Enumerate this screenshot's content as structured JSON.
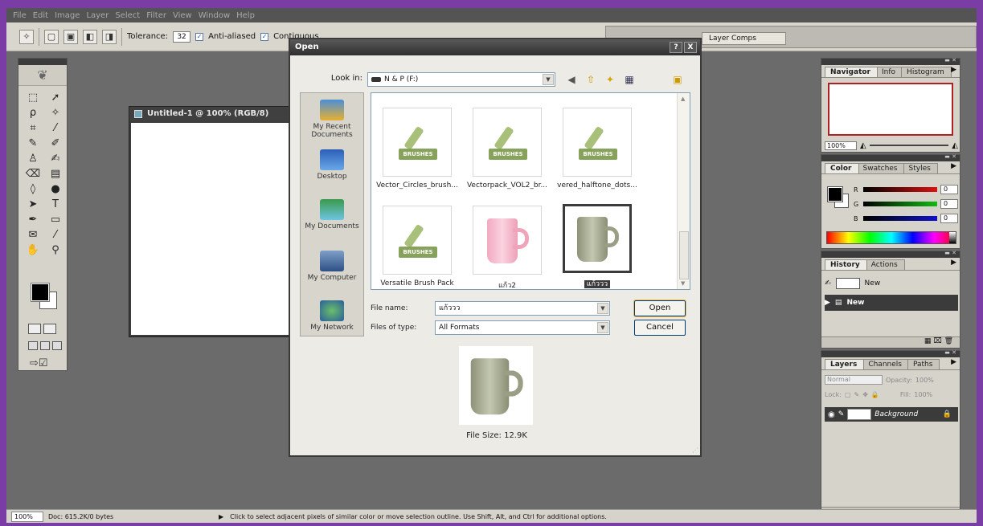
{
  "menubar": [
    "File",
    "Edit",
    "Image",
    "Layer",
    "Select",
    "Filter",
    "View",
    "Window",
    "Help"
  ],
  "options": {
    "tolerance_label": "Tolerance:",
    "tolerance_value": "32",
    "antialiased_label": "Anti-aliased",
    "contiguous_label": "Contiguous"
  },
  "palette_well": {
    "layer_comps": "Layer Comps"
  },
  "document": {
    "title": "Untitled-1 @ 100% (RGB/8)"
  },
  "dialog": {
    "title": "Open",
    "help_btn": "?",
    "close_btn": "X",
    "look_in_label": "Look in:",
    "look_in_value": "N & P (F:)",
    "places": [
      "My Recent Documents",
      "Desktop",
      "My Documents",
      "My Computer",
      "My Network"
    ],
    "files": [
      {
        "name": "Vector_Circles_brush...",
        "type": "brush"
      },
      {
        "name": "Vectorpack_VOL2_br...",
        "type": "brush"
      },
      {
        "name": "vered_halftone_dots...",
        "type": "brush"
      },
      {
        "name": "Versatile Brush Pack",
        "type": "brush"
      },
      {
        "name": "แก้ว2",
        "type": "mug-pink"
      },
      {
        "name": "แก้ววว",
        "type": "mug-gray",
        "selected": true
      }
    ],
    "brush_label": "BRUSHES",
    "file_name_label": "File name:",
    "file_name_value": "แก้ววว",
    "files_of_type_label": "Files of type:",
    "files_of_type_value": "All Formats",
    "open_btn": "Open",
    "cancel_btn": "Cancel",
    "file_size": "File Size: 12.9K"
  },
  "navigator": {
    "tabs": [
      "Navigator",
      "Info",
      "Histogram"
    ],
    "zoom": "100%"
  },
  "color": {
    "tabs": [
      "Color",
      "Swatches",
      "Styles"
    ],
    "channels": [
      {
        "label": "R",
        "value": "0",
        "color": "#d11"
      },
      {
        "label": "G",
        "value": "0",
        "color": "#1b1"
      },
      {
        "label": "B",
        "value": "0",
        "color": "#11c"
      }
    ]
  },
  "history": {
    "tabs": [
      "History",
      "Actions"
    ],
    "snapshot": "New",
    "state": "New"
  },
  "layers": {
    "tabs": [
      "Layers",
      "Channels",
      "Paths"
    ],
    "blend_mode": "Normal",
    "opacity_label": "Opacity:",
    "opacity_value": "100%",
    "lock_label": "Lock:",
    "fill_label": "Fill:",
    "fill_value": "100%",
    "layer_name": "Background"
  },
  "status": {
    "zoom": "100%",
    "doc": "Doc: 615.2K/0 bytes",
    "hint": "Click to select adjacent pixels of similar color or move selection outline.  Use Shift, Alt, and Ctrl for additional options."
  }
}
